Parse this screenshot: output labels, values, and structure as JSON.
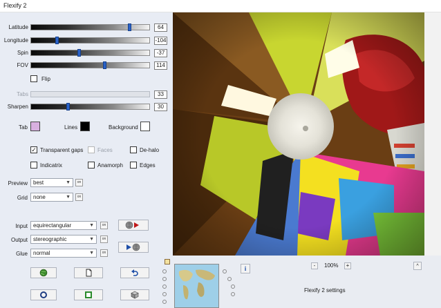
{
  "window": {
    "title": "Flexify 2"
  },
  "sliders": [
    {
      "key": "latitude",
      "label": "Latitude",
      "value": "64",
      "position": 0.82,
      "enabled": true
    },
    {
      "key": "longitude",
      "label": "Longitude",
      "value": "-104",
      "position": 0.2,
      "enabled": true
    },
    {
      "key": "spin",
      "label": "Spin",
      "value": "-37",
      "position": 0.4,
      "enabled": true
    },
    {
      "key": "fov",
      "label": "FOV",
      "value": "114",
      "position": 0.61,
      "enabled": true
    },
    {
      "key": "tabs",
      "label": "Tabs",
      "value": "33",
      "position": 0.0,
      "enabled": false
    },
    {
      "key": "sharpen",
      "label": "Sharpen",
      "value": "30",
      "position": 0.3,
      "enabled": true
    }
  ],
  "flip": {
    "label": "Flip",
    "checked": false
  },
  "colors": {
    "tab": {
      "label": "Tab",
      "value": "#d8b0e0"
    },
    "lines": {
      "label": "Lines",
      "value": "#000000"
    },
    "background": {
      "label": "Background",
      "value": "#ffffff"
    },
    "slider_thumb": "#2a62c8"
  },
  "options": {
    "transparent_gaps": {
      "label": "Transparent gaps",
      "checked": true
    },
    "faces": {
      "label": "Faces",
      "checked": false
    },
    "de_halo": {
      "label": "De-halo",
      "checked": false
    },
    "indicatrix": {
      "label": "Indicatrix",
      "checked": false
    },
    "anamorph": {
      "label": "Anamorph",
      "checked": false
    },
    "edges": {
      "label": "Edges",
      "checked": false
    }
  },
  "preview": {
    "label": "Preview",
    "value": "best",
    "button": "on"
  },
  "grid": {
    "label": "Grid",
    "value": "none",
    "button": "on"
  },
  "input": {
    "label": "Input",
    "value": "equirectangular",
    "button": "on"
  },
  "output": {
    "label": "Output",
    "value": "stereographic",
    "button": "on"
  },
  "glue": {
    "label": "Glue",
    "value": "normal",
    "button": "on"
  },
  "action_icons": {
    "swap_forward": "globe-to-arrow-icon",
    "swap_back": "arrow-to-globe-icon",
    "row1": [
      "globe-icon",
      "page-icon",
      "undo-icon"
    ],
    "row2": [
      "circle-icon",
      "square-icon",
      "cube-icon"
    ]
  },
  "footer": {
    "info": "i",
    "zoom_minus": "-",
    "zoom_value": "100%",
    "zoom_plus": "+",
    "collapse": "^",
    "settings_title": "Flexify 2 settings"
  }
}
